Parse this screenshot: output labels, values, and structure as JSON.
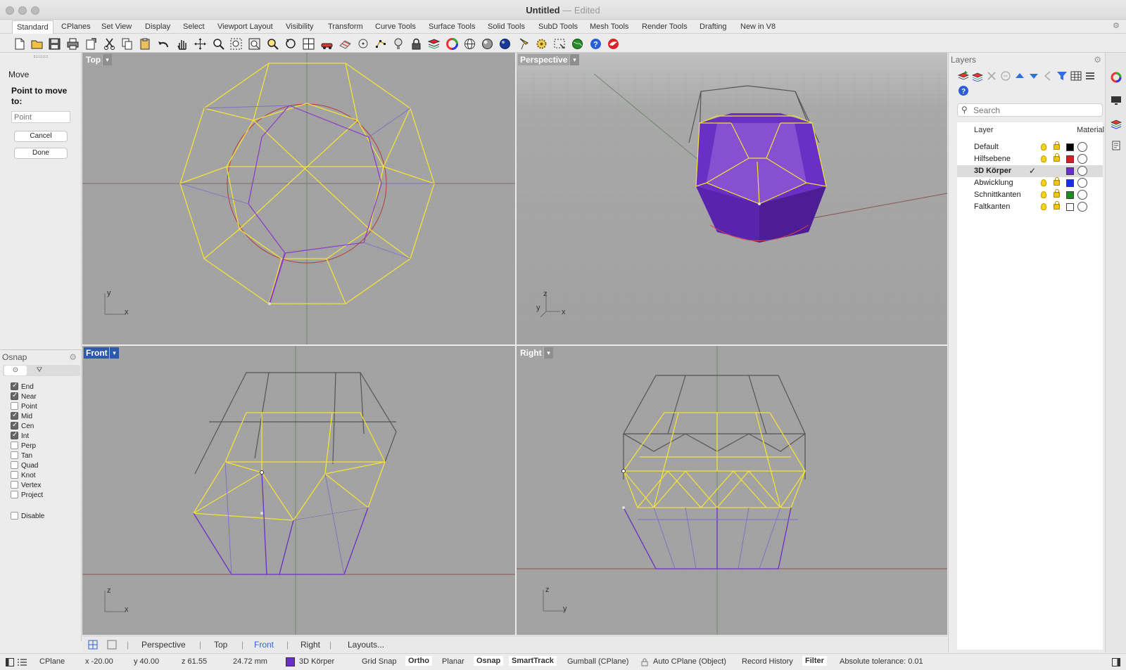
{
  "window": {
    "title": "Untitled",
    "subtitle": "Edited"
  },
  "tabs": [
    "Standard",
    "CPlanes",
    "Set View",
    "Display",
    "Select",
    "Viewport Layout",
    "Visibility",
    "Transform",
    "Curve Tools",
    "Surface Tools",
    "Solid Tools",
    "SubD Tools",
    "Mesh Tools",
    "Render Tools",
    "Drafting",
    "New in V8"
  ],
  "command": {
    "name": "Move",
    "prompt": "Point to move to:",
    "input_placeholder": "Point",
    "cancel_label": "Cancel",
    "done_label": "Done"
  },
  "osnap": {
    "title": "Osnap",
    "items": [
      {
        "label": "End",
        "checked": true
      },
      {
        "label": "Near",
        "checked": true
      },
      {
        "label": "Point",
        "checked": false
      },
      {
        "label": "Mid",
        "checked": true
      },
      {
        "label": "Cen",
        "checked": true
      },
      {
        "label": "Int",
        "checked": true
      },
      {
        "label": "Perp",
        "checked": false
      },
      {
        "label": "Tan",
        "checked": false
      },
      {
        "label": "Quad",
        "checked": false
      },
      {
        "label": "Knot",
        "checked": false
      },
      {
        "label": "Vertex",
        "checked": false
      },
      {
        "label": "Project",
        "checked": false
      }
    ],
    "disable_label": "Disable"
  },
  "viewports": {
    "top": {
      "label": "Top",
      "axis_y": "y",
      "axis_x": "x"
    },
    "perspective": {
      "label": "Perspective",
      "axis_z": "z",
      "axis_y": "y",
      "axis_x": "x"
    },
    "front": {
      "label": "Front",
      "axis_z": "z",
      "axis_x": "x"
    },
    "right": {
      "label": "Right",
      "axis_z": "z",
      "axis_y": "y"
    },
    "active": "Front"
  },
  "viewport_tabs": [
    "Perspective",
    "Top",
    "Front",
    "Right",
    "Layouts..."
  ],
  "status": {
    "cplane": "CPlane",
    "x": "x -20.00",
    "y": "y 40.00",
    "z": "z 61.55",
    "distance": "24.72 mm",
    "layer": "3D Körper",
    "layer_color": "#6a2fc4",
    "grid_snap": "Grid Snap",
    "ortho": "Ortho",
    "planar": "Planar",
    "osnap": "Osnap",
    "smarttrack": "SmartTrack",
    "gumball": "Gumball (CPlane)",
    "autocplane": "Auto CPlane (Object)",
    "record_history": "Record History",
    "filter": "Filter",
    "tolerance": "Absolute tolerance: 0.01"
  },
  "layers": {
    "title": "Layers",
    "search_placeholder": "Search",
    "col_layer": "Layer",
    "col_material": "Material",
    "rows": [
      {
        "name": "Default",
        "color": "#000000",
        "current": false
      },
      {
        "name": "Hilfsebene",
        "color": "#d42020",
        "current": false
      },
      {
        "name": "3D Körper",
        "color": "#6a2fc4",
        "current": true
      },
      {
        "name": "Abwicklung",
        "color": "#1a2ee8",
        "current": false
      },
      {
        "name": "Schnittkanten",
        "color": "#1f8a1f",
        "current": false
      },
      {
        "name": "Faltkanten",
        "color": "#ffffff",
        "current": false
      }
    ],
    "current_mark": "✓"
  },
  "colors": {
    "viewport_bg": "#a3a3a3",
    "wire_yellow": "#f2e23a",
    "solid_purple": "#6a2fc4",
    "active_label": "#2d5aa8"
  }
}
